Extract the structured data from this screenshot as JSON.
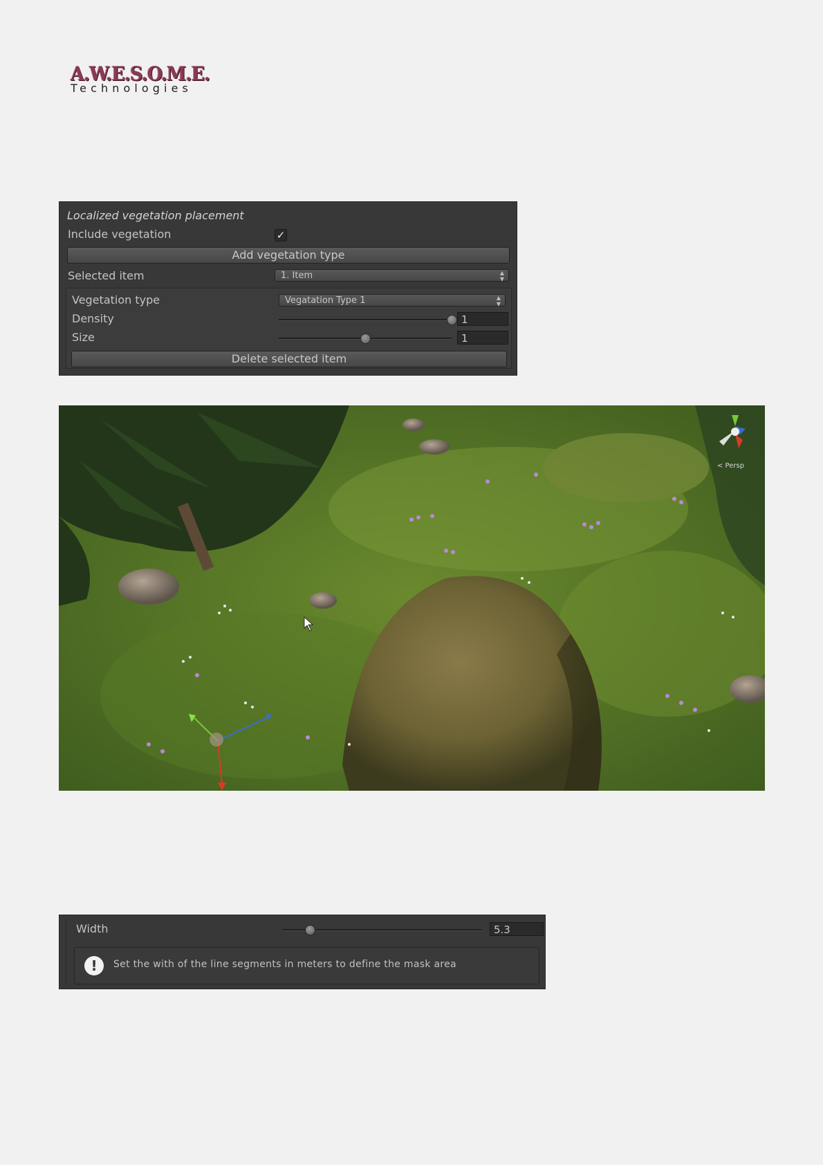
{
  "logo": {
    "main": "A.W.E.S.O.M.E.",
    "sub": "Technologies"
  },
  "vegetation_panel": {
    "header": "Localized vegetation placement",
    "include_vegetation_label": "Include vegetation",
    "include_vegetation_checked": true,
    "add_button_label": "Add vegetation type",
    "selected_item_label": "Selected item",
    "selected_item_value": "1. Item",
    "vegetation_type_label": "Vegetation type",
    "vegetation_type_value": "Vegatation Type 1",
    "density_label": "Density",
    "density_value": "1",
    "density_fraction": 1.0,
    "size_label": "Size",
    "size_value": "1",
    "size_fraction": 0.5,
    "delete_button_label": "Delete selected item"
  },
  "scene_view": {
    "projection_label": "< Persp"
  },
  "width_panel": {
    "width_label": "Width",
    "width_value": "5.3",
    "width_fraction": 0.14,
    "help_icon": "exclamation-icon",
    "help_text": "Set the with of the line segments in meters to define the mask area"
  }
}
